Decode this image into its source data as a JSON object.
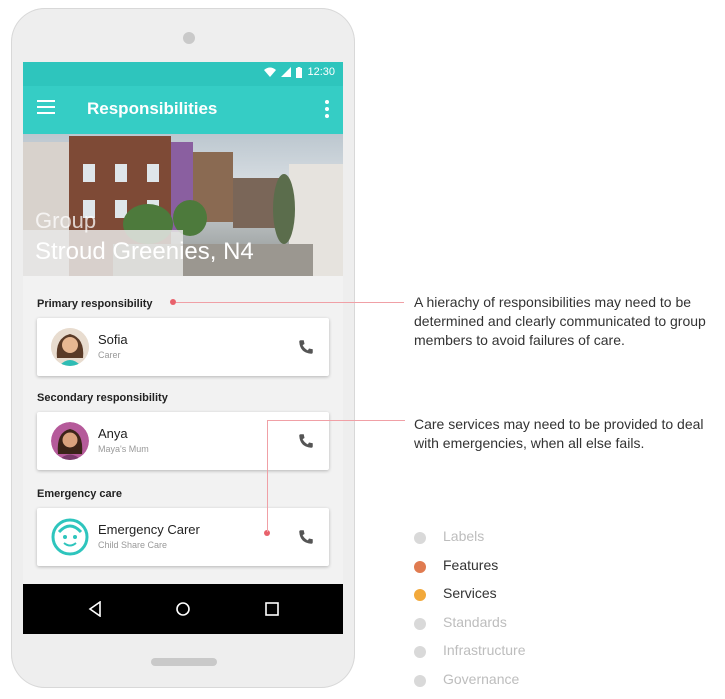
{
  "status": {
    "time": "12:30"
  },
  "appbar": {
    "title": "Responsibilities"
  },
  "hero": {
    "overline": "Group",
    "title": "Stroud Greenies, N4"
  },
  "sections": [
    {
      "label": "Primary responsibility",
      "name": "Sofia",
      "role": "Carer"
    },
    {
      "label": "Secondary responsibility",
      "name": "Anya",
      "role": "Maya's Mum"
    },
    {
      "label": "Emergency care",
      "name": "Emergency Carer",
      "role": "Child Share Care"
    }
  ],
  "annotations": [
    "A hierachy of responsibilities may need to be determined and clearly communicated to group members to avoid failures of care.",
    "Care services may need to be provided to deal with emergencies, when all else fails."
  ],
  "legend": [
    {
      "label": "Labels",
      "color": "#d9d9d9",
      "muted": true
    },
    {
      "label": "Features",
      "color": "#e07b50",
      "muted": false
    },
    {
      "label": "Services",
      "color": "#f2a93b",
      "muted": false
    },
    {
      "label": "Standards",
      "color": "#d9d9d9",
      "muted": true
    },
    {
      "label": "Infrastructure",
      "color": "#d9d9d9",
      "muted": true
    },
    {
      "label": "Governance",
      "color": "#d9d9d9",
      "muted": true
    }
  ],
  "colors": {
    "teal": "#35cdc5",
    "status_teal": "#2ec5bd",
    "annotation_red": "#e8616b"
  }
}
